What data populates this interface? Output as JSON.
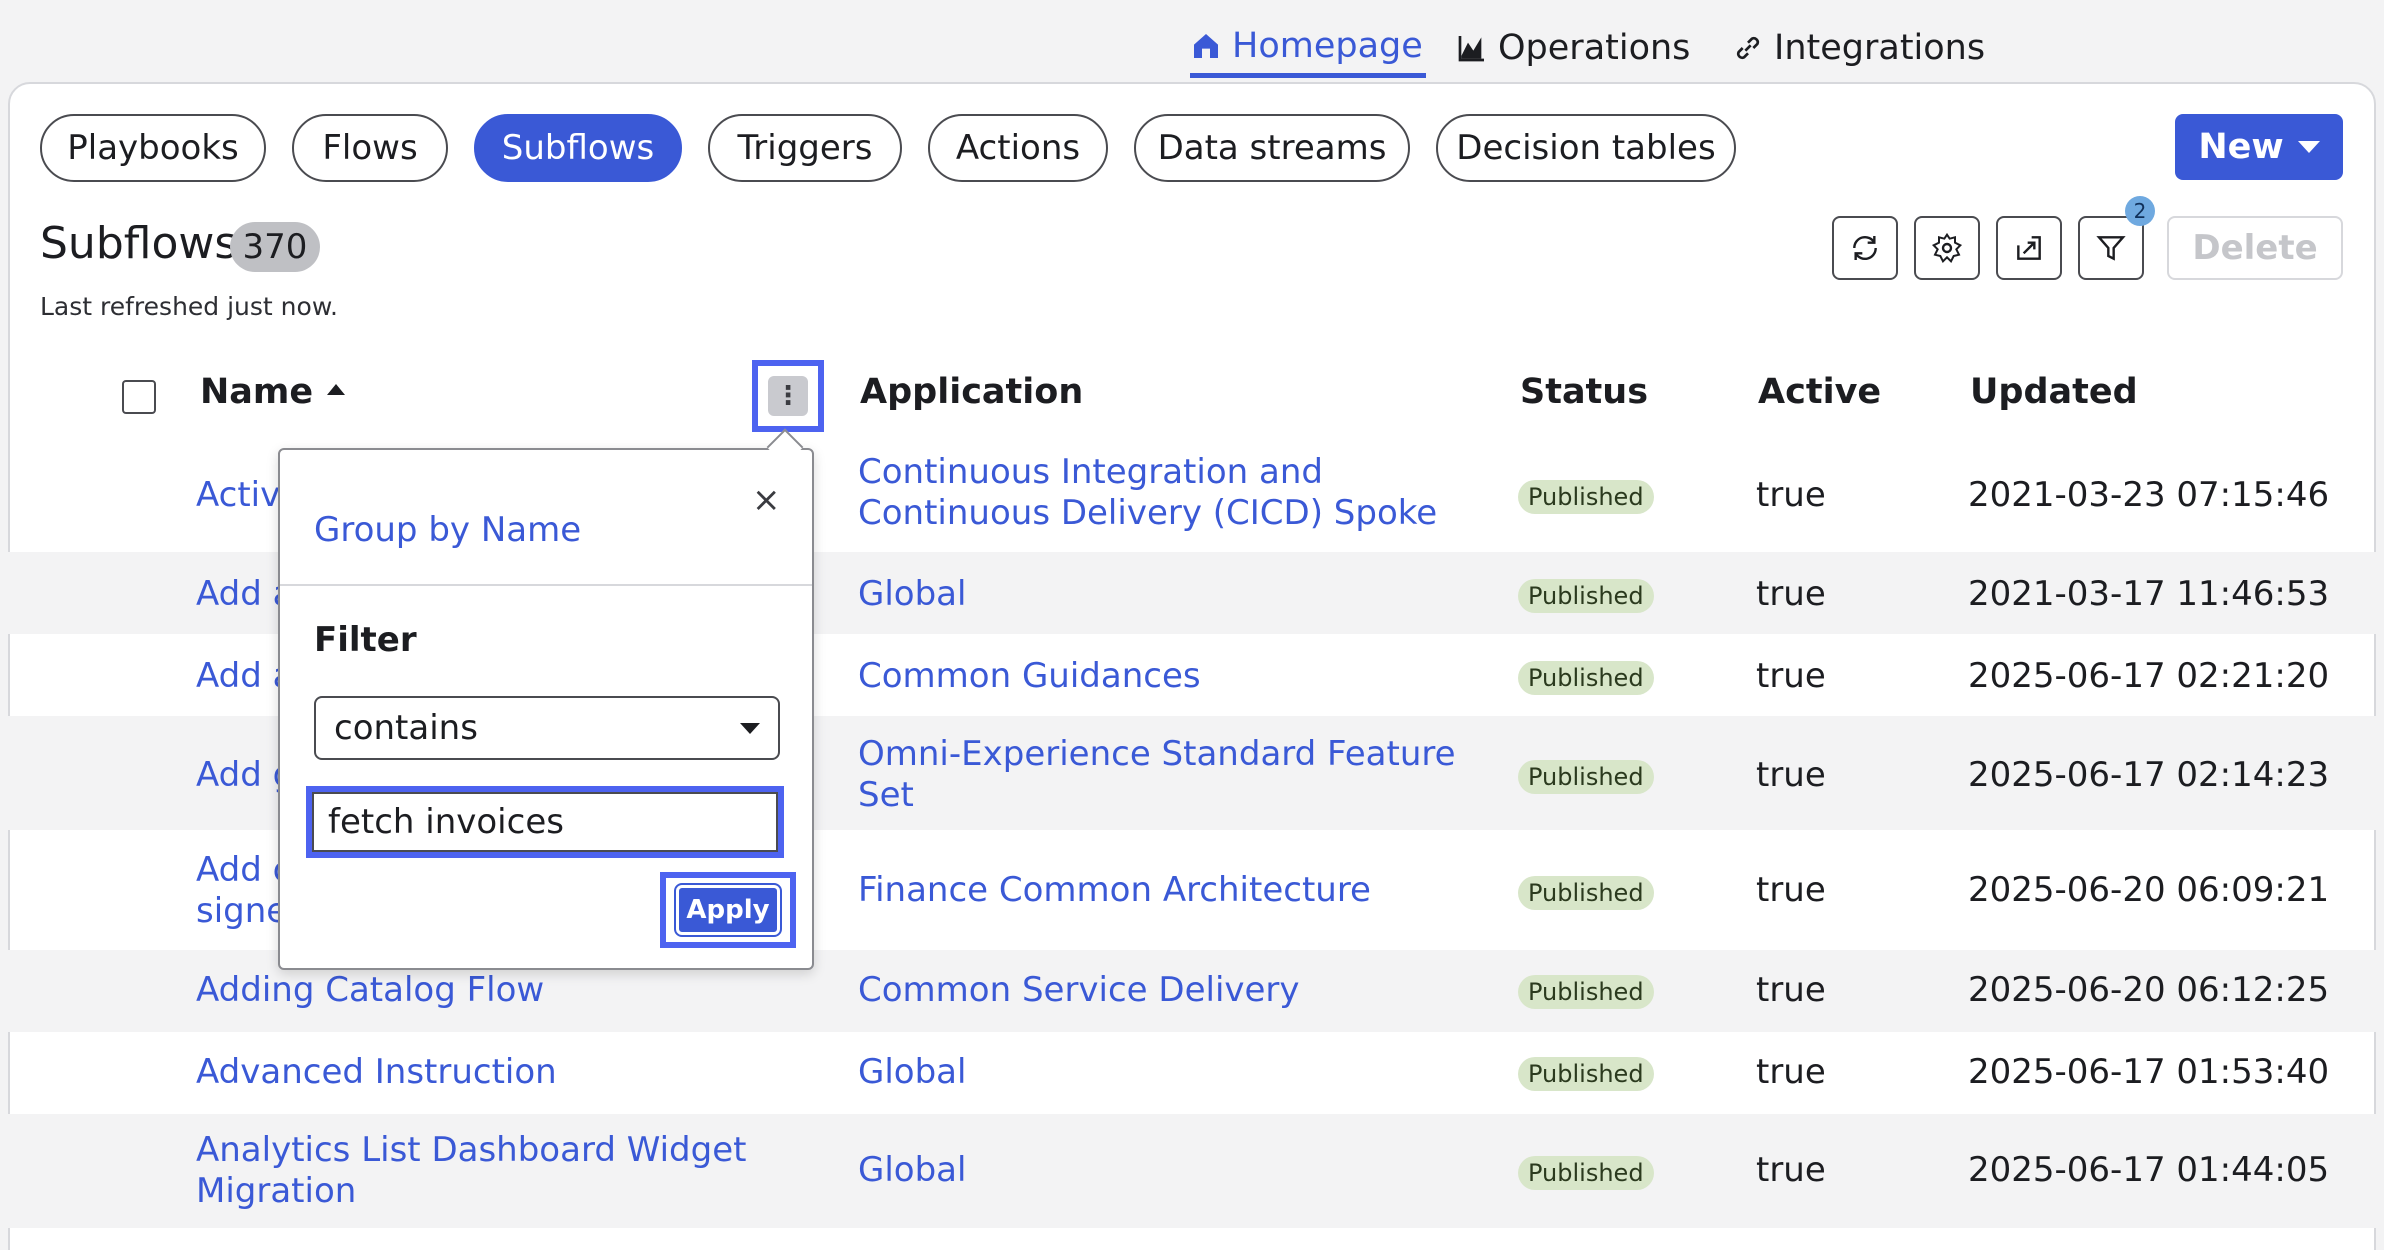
{
  "top_nav": {
    "tabs": [
      {
        "label": "Homepage",
        "icon": "home-icon",
        "active": true
      },
      {
        "label": "Operations",
        "icon": "chart-icon",
        "active": false
      },
      {
        "label": "Integrations",
        "icon": "link-icon",
        "active": false
      }
    ]
  },
  "categories": {
    "items": [
      "Playbooks",
      "Flows",
      "Subflows",
      "Triggers",
      "Actions",
      "Data streams",
      "Decision tables"
    ],
    "active": "Subflows"
  },
  "toolbar": {
    "new_label": "New",
    "delete_label": "Delete",
    "filter_count": "2",
    "icons": [
      "refresh-icon",
      "gear-icon",
      "export-icon",
      "filter-icon"
    ]
  },
  "header": {
    "title": "Subflows",
    "count": "370",
    "refreshed": "Last refreshed just now."
  },
  "table": {
    "columns": [
      "Name",
      "Application",
      "Status",
      "Active",
      "Updated"
    ],
    "rows": [
      {
        "name": "Activa",
        "application": [
          "Continuous Integration and",
          "Continuous Delivery (CICD) Spoke"
        ],
        "status": "Published",
        "active": "true",
        "updated": "2021-03-23 07:15:46"
      },
      {
        "name": "Add a",
        "application": [
          "Global"
        ],
        "status": "Published",
        "active": "true",
        "updated": "2021-03-17 11:46:53"
      },
      {
        "name": "Add a",
        "application": [
          "Common Guidances"
        ],
        "status": "Published",
        "active": "true",
        "updated": "2025-06-17 02:21:20"
      },
      {
        "name": "Add g",
        "application": [
          "Omni-Experience Standard Feature",
          "Set"
        ],
        "status": "Published",
        "active": "true",
        "updated": "2025-06-17 02:14:23"
      },
      {
        "name": "Add c",
        "name2": "signe",
        "application": [
          "Finance Common Architecture"
        ],
        "status": "Published",
        "active": "true",
        "updated": "2025-06-20 06:09:21"
      },
      {
        "name": "Adding Catalog Flow",
        "application": [
          "Common Service Delivery"
        ],
        "status": "Published",
        "active": "true",
        "updated": "2025-06-20 06:12:25"
      },
      {
        "name": "Advanced Instruction",
        "application": [
          "Global"
        ],
        "status": "Published",
        "active": "true",
        "updated": "2025-06-17 01:53:40"
      },
      {
        "name": "Analytics List Dashboard Widget",
        "name2": "Migration",
        "application": [
          "Global"
        ],
        "status": "Published",
        "active": "true",
        "updated": "2025-06-17 01:44:05"
      }
    ]
  },
  "popover": {
    "group_by": "Group by Name",
    "filter_label": "Filter",
    "operator": "contains",
    "value": "fetch invoices",
    "apply_label": "Apply",
    "close_symbol": "×"
  },
  "colors": {
    "accent": "#3a59d6",
    "highlight": "#4d63f0",
    "status_bg": "#d8e6c9"
  }
}
